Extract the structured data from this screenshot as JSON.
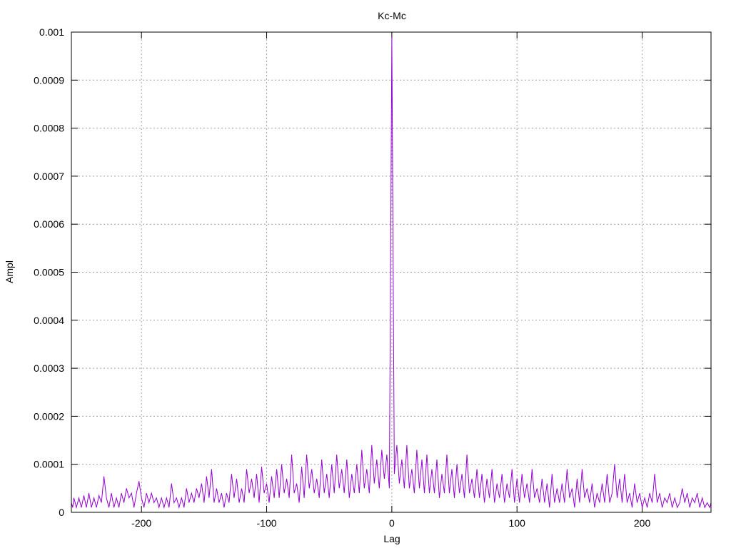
{
  "chart_data": {
    "type": "line",
    "title": "Kc-Mc",
    "xlabel": "Lag",
    "ylabel": "Ampl",
    "xlim": [
      -256,
      255
    ],
    "ylim": [
      0,
      0.001
    ],
    "xticks": [
      -200,
      -100,
      0,
      100,
      200
    ],
    "xtick_labels": [
      "-200",
      "-100",
      "0",
      "100",
      "200"
    ],
    "yticks": [
      0,
      0.0001,
      0.0002,
      0.0003,
      0.0004,
      0.0005,
      0.0006,
      0.0007,
      0.0008,
      0.0009,
      0.001
    ],
    "ytick_labels": [
      "0",
      "0.0001",
      "0.0002",
      "0.0003",
      "0.0004",
      "0.0005",
      "0.0006",
      "0.0007",
      "0.0008",
      "0.0009",
      "0.001"
    ],
    "grid": true,
    "line_color": "#9400d3",
    "series": [
      {
        "points": [
          [
            -256,
            2e-05
          ],
          [
            -255,
            1e-05
          ],
          [
            -254,
            3e-05
          ],
          [
            -252,
            1e-05
          ],
          [
            -250,
            3e-05
          ],
          [
            -248,
            1e-05
          ],
          [
            -246,
            3.5e-05
          ],
          [
            -244,
            1e-05
          ],
          [
            -242,
            4e-05
          ],
          [
            -240,
            1e-05
          ],
          [
            -238,
            3e-05
          ],
          [
            -236,
            1e-05
          ],
          [
            -234,
            3.5e-05
          ],
          [
            -232,
            2e-05
          ],
          [
            -230,
            7.5e-05
          ],
          [
            -228,
            3e-05
          ],
          [
            -226,
            1e-05
          ],
          [
            -224,
            4e-05
          ],
          [
            -222,
            1e-05
          ],
          [
            -220,
            3e-05
          ],
          [
            -218,
            1e-05
          ],
          [
            -216,
            4e-05
          ],
          [
            -214,
            2e-05
          ],
          [
            -212,
            5e-05
          ],
          [
            -210,
            3e-05
          ],
          [
            -208,
            4e-05
          ],
          [
            -206,
            1e-05
          ],
          [
            -204,
            4e-05
          ],
          [
            -202,
            6.5e-05
          ],
          [
            -200,
            3e-05
          ],
          [
            -198,
            1e-05
          ],
          [
            -196,
            4e-05
          ],
          [
            -194,
            2e-05
          ],
          [
            -192,
            4e-05
          ],
          [
            -190,
            2e-05
          ],
          [
            -188,
            3e-05
          ],
          [
            -186,
            1e-05
          ],
          [
            -184,
            3e-05
          ],
          [
            -182,
            1e-05
          ],
          [
            -180,
            3e-05
          ],
          [
            -178,
            1e-05
          ],
          [
            -176,
            6e-05
          ],
          [
            -174,
            2e-05
          ],
          [
            -172,
            3e-05
          ],
          [
            -170,
            1e-05
          ],
          [
            -168,
            3e-05
          ],
          [
            -166,
            1e-05
          ],
          [
            -164,
            5e-05
          ],
          [
            -162,
            2e-05
          ],
          [
            -160,
            4e-05
          ],
          [
            -158,
            2e-05
          ],
          [
            -156,
            5e-05
          ],
          [
            -154,
            3e-05
          ],
          [
            -152,
            6e-05
          ],
          [
            -150,
            2e-05
          ],
          [
            -148,
            7.5e-05
          ],
          [
            -146,
            3e-05
          ],
          [
            -144,
            9e-05
          ],
          [
            -142,
            2e-05
          ],
          [
            -140,
            5e-05
          ],
          [
            -138,
            2e-05
          ],
          [
            -136,
            4e-05
          ],
          [
            -134,
            1e-05
          ],
          [
            -132,
            4e-05
          ],
          [
            -130,
            2e-05
          ],
          [
            -128,
            8e-05
          ],
          [
            -126,
            3e-05
          ],
          [
            -124,
            7e-05
          ],
          [
            -122,
            2e-05
          ],
          [
            -120,
            5e-05
          ],
          [
            -118,
            2e-05
          ],
          [
            -116,
            9e-05
          ],
          [
            -114,
            4e-05
          ],
          [
            -112,
            7e-05
          ],
          [
            -110,
            3e-05
          ],
          [
            -108,
            8e-05
          ],
          [
            -106,
            2e-05
          ],
          [
            -104,
            9.5e-05
          ],
          [
            -102,
            4e-05
          ],
          [
            -100,
            6e-05
          ],
          [
            -98,
            2e-05
          ],
          [
            -96,
            7.5e-05
          ],
          [
            -94,
            3e-05
          ],
          [
            -92,
            9e-05
          ],
          [
            -90,
            3e-05
          ],
          [
            -88,
            0.0001
          ],
          [
            -86,
            4e-05
          ],
          [
            -84,
            7e-05
          ],
          [
            -82,
            3e-05
          ],
          [
            -80,
            0.00012
          ],
          [
            -78,
            4e-05
          ],
          [
            -76,
            6e-05
          ],
          [
            -74,
            2e-05
          ],
          [
            -72,
            9.5e-05
          ],
          [
            -70,
            3e-05
          ],
          [
            -68,
            0.00012
          ],
          [
            -66,
            5e-05
          ],
          [
            -64,
            9e-05
          ],
          [
            -62,
            4e-05
          ],
          [
            -60,
            7e-05
          ],
          [
            -58,
            3e-05
          ],
          [
            -56,
            0.00011
          ],
          [
            -54,
            4e-05
          ],
          [
            -52,
            8e-05
          ],
          [
            -50,
            3e-05
          ],
          [
            -48,
            0.0001
          ],
          [
            -46,
            4e-05
          ],
          [
            -44,
            0.00012
          ],
          [
            -42,
            5e-05
          ],
          [
            -40,
            9e-05
          ],
          [
            -38,
            4e-05
          ],
          [
            -36,
            0.00011
          ],
          [
            -34,
            3e-05
          ],
          [
            -32,
            8e-05
          ],
          [
            -30,
            4e-05
          ],
          [
            -28,
            0.0001
          ],
          [
            -26,
            4e-05
          ],
          [
            -24,
            0.00013
          ],
          [
            -22,
            5e-05
          ],
          [
            -20,
            9e-05
          ],
          [
            -18,
            4e-05
          ],
          [
            -16,
            0.00014
          ],
          [
            -14,
            6e-05
          ],
          [
            -12,
            0.00011
          ],
          [
            -10,
            5e-05
          ],
          [
            -8,
            0.00013
          ],
          [
            -6,
            7e-05
          ],
          [
            -4,
            0.00012
          ],
          [
            -2,
            5e-05
          ],
          [
            0,
            0.00099
          ],
          [
            2,
            8e-05
          ],
          [
            4,
            0.00014
          ],
          [
            6,
            6e-05
          ],
          [
            8,
            0.00011
          ],
          [
            10,
            5e-05
          ],
          [
            12,
            0.00014
          ],
          [
            14,
            5e-05
          ],
          [
            16,
            9e-05
          ],
          [
            18,
            4e-05
          ],
          [
            20,
            0.00013
          ],
          [
            22,
            5e-05
          ],
          [
            24,
            0.00011
          ],
          [
            26,
            4e-05
          ],
          [
            28,
            0.00012
          ],
          [
            30,
            4e-05
          ],
          [
            32,
            9e-05
          ],
          [
            34,
            4e-05
          ],
          [
            36,
            0.00011
          ],
          [
            38,
            3e-05
          ],
          [
            40,
            8e-05
          ],
          [
            42,
            4e-05
          ],
          [
            44,
            0.00012
          ],
          [
            46,
            4e-05
          ],
          [
            48,
            9e-05
          ],
          [
            50,
            3e-05
          ],
          [
            52,
            0.0001
          ],
          [
            54,
            4e-05
          ],
          [
            56,
            8e-05
          ],
          [
            58,
            3e-05
          ],
          [
            60,
            0.00012
          ],
          [
            62,
            4e-05
          ],
          [
            64,
            7e-05
          ],
          [
            66,
            3e-05
          ],
          [
            68,
            9e-05
          ],
          [
            70,
            3e-05
          ],
          [
            72,
            8e-05
          ],
          [
            74,
            2e-05
          ],
          [
            76,
            7e-05
          ],
          [
            78,
            3e-05
          ],
          [
            80,
            9e-05
          ],
          [
            82,
            2e-05
          ],
          [
            84,
            6e-05
          ],
          [
            86,
            3e-05
          ],
          [
            88,
            8e-05
          ],
          [
            90,
            2e-05
          ],
          [
            92,
            6e-05
          ],
          [
            94,
            3e-05
          ],
          [
            96,
            9e-05
          ],
          [
            98,
            2e-05
          ],
          [
            100,
            7e-05
          ],
          [
            102,
            2e-05
          ],
          [
            104,
            8e-05
          ],
          [
            106,
            3e-05
          ],
          [
            108,
            6e-05
          ],
          [
            110,
            2e-05
          ],
          [
            112,
            9e-05
          ],
          [
            114,
            3e-05
          ],
          [
            116,
            5e-05
          ],
          [
            118,
            2e-05
          ],
          [
            120,
            7e-05
          ],
          [
            122,
            2e-05
          ],
          [
            124,
            6e-05
          ],
          [
            126,
            1e-05
          ],
          [
            128,
            8e-05
          ],
          [
            130,
            2e-05
          ],
          [
            132,
            5e-05
          ],
          [
            134,
            2e-05
          ],
          [
            136,
            6e-05
          ],
          [
            138,
            2e-05
          ],
          [
            140,
            9e-05
          ],
          [
            142,
            3e-05
          ],
          [
            144,
            5e-05
          ],
          [
            146,
            1e-05
          ],
          [
            148,
            7e-05
          ],
          [
            150,
            2e-05
          ],
          [
            152,
            9e-05
          ],
          [
            154,
            3e-05
          ],
          [
            156,
            5e-05
          ],
          [
            158,
            2e-05
          ],
          [
            160,
            6e-05
          ],
          [
            162,
            1e-05
          ],
          [
            164,
            4e-05
          ],
          [
            166,
            2e-05
          ],
          [
            168,
            6e-05
          ],
          [
            170,
            2e-05
          ],
          [
            172,
            8e-05
          ],
          [
            174,
            2e-05
          ],
          [
            176,
            4e-05
          ],
          [
            178,
            0.0001
          ],
          [
            180,
            3e-05
          ],
          [
            182,
            7e-05
          ],
          [
            184,
            2e-05
          ],
          [
            186,
            8e-05
          ],
          [
            188,
            2e-05
          ],
          [
            190,
            4e-05
          ],
          [
            192,
            1e-05
          ],
          [
            194,
            6e-05
          ],
          [
            196,
            2e-05
          ],
          [
            198,
            4e-05
          ],
          [
            200,
            1e-05
          ],
          [
            202,
            3e-05
          ],
          [
            204,
            1e-05
          ],
          [
            206,
            4e-05
          ],
          [
            208,
            2e-05
          ],
          [
            210,
            8e-05
          ],
          [
            212,
            2e-05
          ],
          [
            214,
            4e-05
          ],
          [
            216,
            1e-05
          ],
          [
            218,
            3e-05
          ],
          [
            220,
            2e-05
          ],
          [
            222,
            4e-05
          ],
          [
            224,
            1e-05
          ],
          [
            226,
            3e-05
          ],
          [
            228,
            1e-05
          ],
          [
            230,
            2e-05
          ],
          [
            232,
            5e-05
          ],
          [
            234,
            2e-05
          ],
          [
            236,
            4e-05
          ],
          [
            238,
            1e-05
          ],
          [
            240,
            3e-05
          ],
          [
            242,
            2e-05
          ],
          [
            244,
            4e-05
          ],
          [
            246,
            1e-05
          ],
          [
            248,
            3e-05
          ],
          [
            250,
            1e-05
          ],
          [
            252,
            2e-05
          ],
          [
            254,
            1e-05
          ],
          [
            255,
            2e-05
          ]
        ]
      }
    ]
  }
}
